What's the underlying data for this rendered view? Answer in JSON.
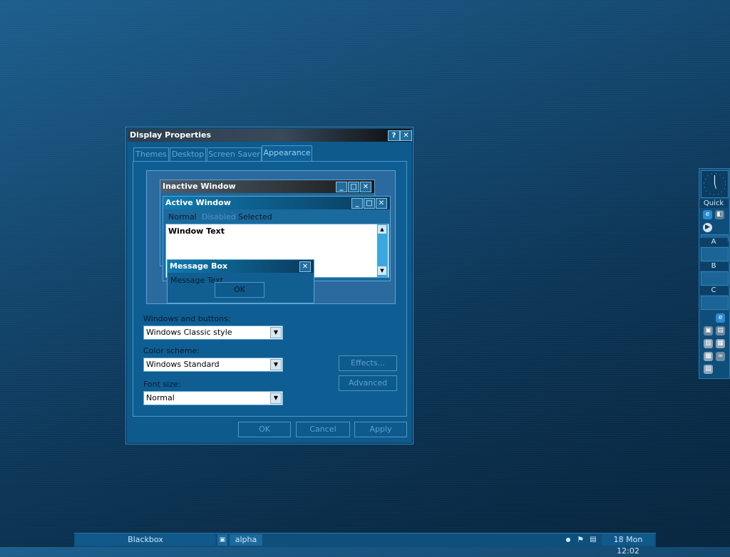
{
  "dialog": {
    "title": "Display Properties",
    "help_label": "?",
    "close_label": "✕",
    "tabs": [
      {
        "label": "Themes"
      },
      {
        "label": "Desktop"
      },
      {
        "label": "Screen Saver"
      },
      {
        "label": "Appearance"
      }
    ],
    "active_tab": "Appearance",
    "preview": {
      "inactive_title": "Inactive Window",
      "active_title": "Active Window",
      "menu_normal": "Normal",
      "menu_disabled": "Disabled",
      "menu_selected": "Selected",
      "window_text": "Window Text",
      "message_title": "Message Box",
      "message_text": "Message Text",
      "ok_label": "OK"
    },
    "windows_buttons_label": "Windows and buttons:",
    "windows_buttons_value": "Windows Classic style",
    "color_scheme_label": "Color scheme:",
    "color_scheme_value": "Windows Standard",
    "font_size_label": "Font size:",
    "font_size_value": "Normal",
    "effects_label": "Effects...",
    "advanced_label": "Advanced",
    "ok_label": "OK",
    "cancel_label": "Cancel",
    "apply_label": "Apply"
  },
  "dock": {
    "quick_label": "Quick",
    "slot_a": "A",
    "slot_b": "B",
    "slot_c": "C"
  },
  "taskbar": {
    "workspace_label": "Blackbox",
    "task_label": "alpha",
    "clock": "18 Mon 12:02"
  },
  "colors": {
    "desktop": "#0c3556",
    "dialog_bg": "#0e5a8c",
    "accent_border": "#4a97c8"
  }
}
